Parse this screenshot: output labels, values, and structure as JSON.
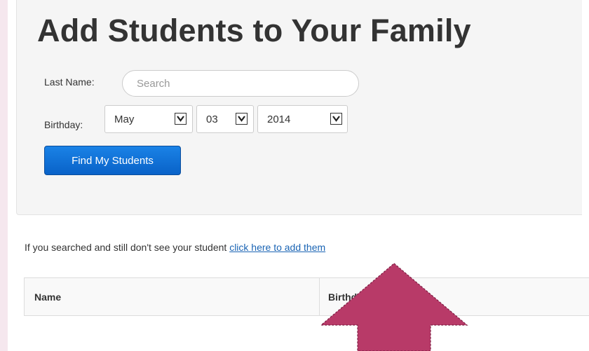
{
  "title": "Add Students to Your Family",
  "form": {
    "last_name_label": "Last Name:",
    "search_placeholder": "Search",
    "birthday_label": "Birthday:",
    "month": "May",
    "day": "03",
    "year": "2014",
    "find_button": "Find My Students"
  },
  "info": {
    "text": "If you searched and still don't see your student ",
    "link": "click here to add them"
  },
  "table": {
    "columns": [
      "Name",
      "Birthday"
    ]
  },
  "colors": {
    "accent": "#0962c8",
    "arrow": "#b83a68"
  }
}
